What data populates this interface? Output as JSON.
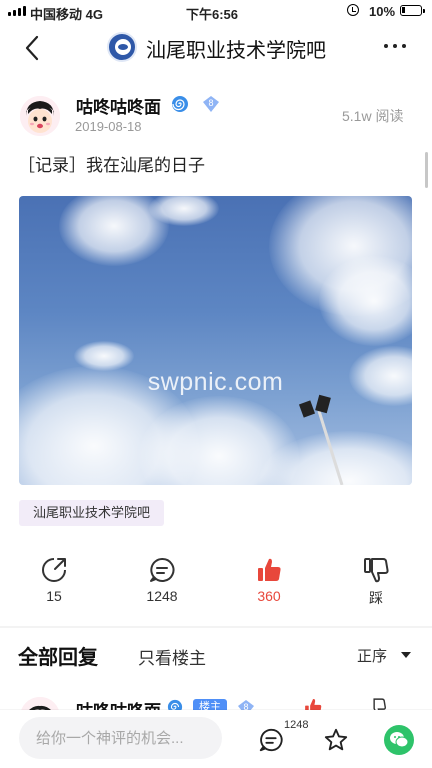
{
  "status_bar": {
    "carrier": "中国移动 4G",
    "time": "下午6:56",
    "battery": "10%"
  },
  "nav": {
    "title": "汕尾职业技术学院吧",
    "back_icon": "chevron-left-icon",
    "more_icon": "more-horizontal-icon"
  },
  "post": {
    "author": "咕咚咕咚面",
    "author_level": "8",
    "date": "2019-08-18",
    "read_count": "5.1w 阅读",
    "title": "［记录］我在汕尾的日子",
    "image_watermark": "swpnic.com",
    "forum_tag": "汕尾职业技术学院吧"
  },
  "actions": {
    "share_count": "15",
    "comment_count": "1248",
    "like_count": "360",
    "dislike_label": "踩"
  },
  "replies_header": {
    "all_tab": "全部回复",
    "op_only_tab": "只看楼主",
    "sort_label": "正序"
  },
  "first_reply": {
    "author": "咕咚咕咚面",
    "op_tag": "楼主",
    "level": "8"
  },
  "bottom_bar": {
    "input_placeholder": "给你一个神评的机会...",
    "comment_count": "1248"
  },
  "colors": {
    "like_red": "#e8473b",
    "op_tag_blue": "#4f8ff7",
    "wechat_green": "#2ec36a",
    "level_badge_blue": "#8fb4f5"
  }
}
